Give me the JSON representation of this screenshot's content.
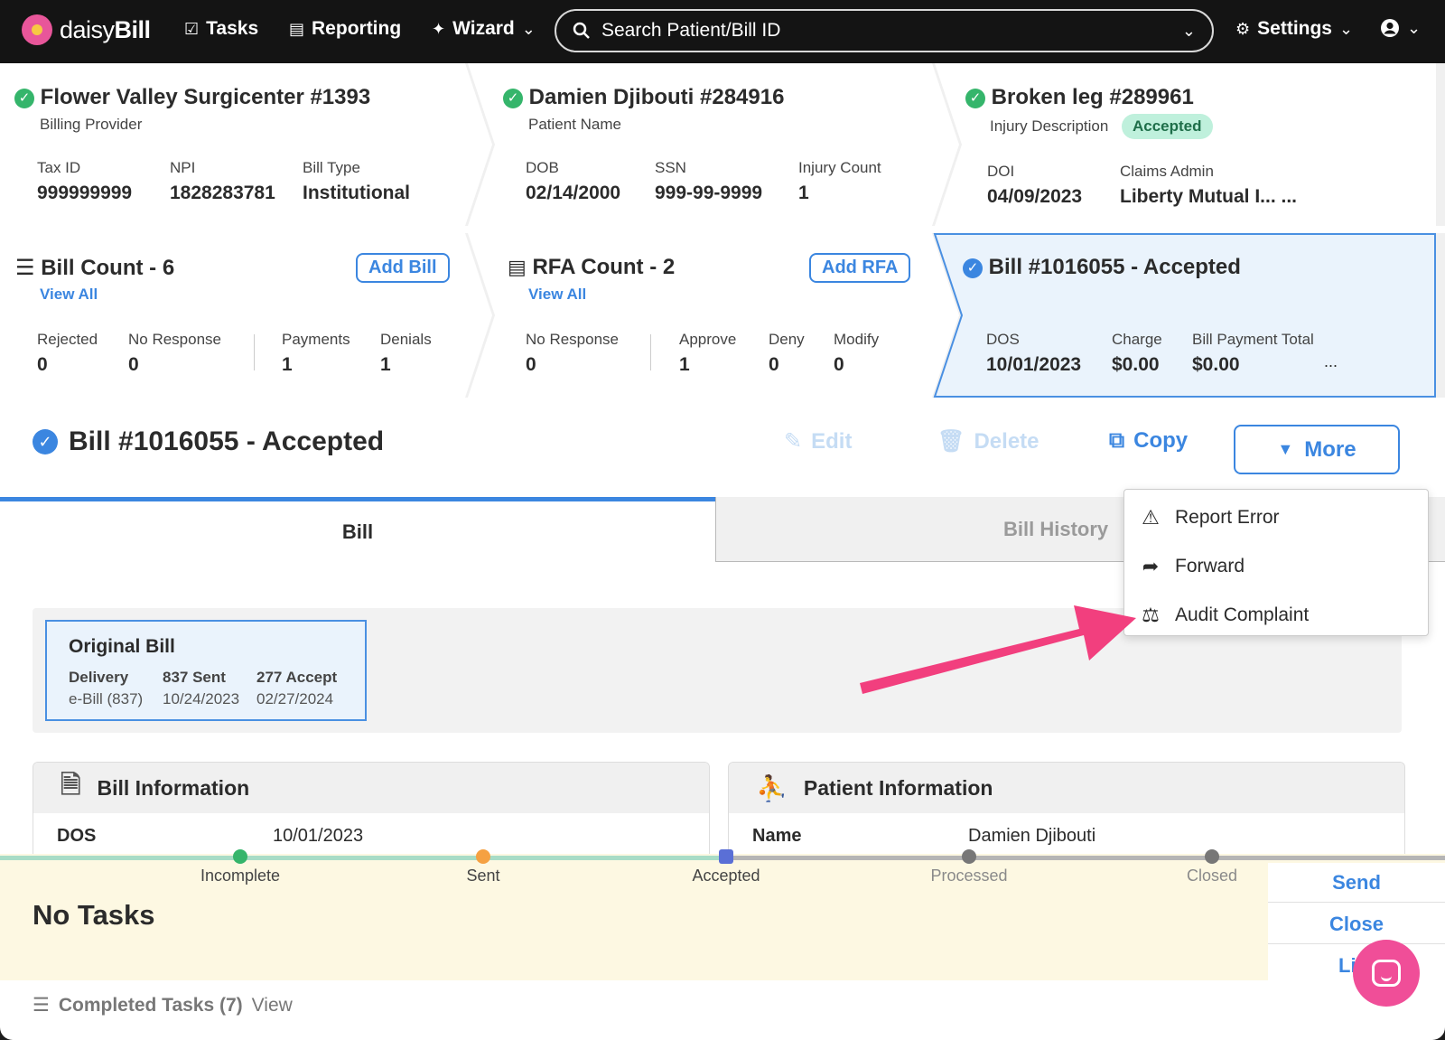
{
  "nav": {
    "logo_light": "daisy",
    "logo_bold": "Bill",
    "tasks": "Tasks",
    "reporting": "Reporting",
    "wizard": "Wizard",
    "search_placeholder": "Search Patient/Bill ID",
    "settings": "Settings"
  },
  "provider": {
    "title": "Flower Valley Surgicenter #1393",
    "subtitle": "Billing Provider",
    "fields": [
      {
        "label": "Tax ID",
        "value": "999999999"
      },
      {
        "label": "NPI",
        "value": "1828283781"
      },
      {
        "label": "Bill Type",
        "value": "Institutional"
      }
    ]
  },
  "patient": {
    "title": "Damien Djibouti #284916",
    "subtitle": "Patient Name",
    "fields": [
      {
        "label": "DOB",
        "value": "02/14/2000"
      },
      {
        "label": "SSN",
        "value": "999-99-9999"
      },
      {
        "label": "Injury Count",
        "value": "1"
      }
    ]
  },
  "injury": {
    "title": "Broken leg #289961",
    "subtitle": "Injury Description",
    "badge": "Accepted",
    "fields": [
      {
        "label": "DOI",
        "value": "04/09/2023"
      },
      {
        "label": "Claims Admin",
        "value": "Liberty Mutual I... ..."
      }
    ]
  },
  "bill_count": {
    "title": "Bill Count - 6",
    "view_all": "View All",
    "add": "Add Bill",
    "fields": [
      {
        "label": "Rejected",
        "value": "0"
      },
      {
        "label": "No Response",
        "value": "0"
      },
      {
        "label": "Payments",
        "value": "1"
      },
      {
        "label": "Denials",
        "value": "1"
      }
    ]
  },
  "rfa_count": {
    "title": "RFA Count - 2",
    "view_all": "View All",
    "add": "Add RFA",
    "fields": [
      {
        "label": "No Response",
        "value": "0"
      },
      {
        "label": "Approve",
        "value": "1"
      },
      {
        "label": "Deny",
        "value": "0"
      },
      {
        "label": "Modify",
        "value": "0"
      }
    ]
  },
  "bill_card": {
    "title": "Bill #1016055 - Accepted",
    "fields": [
      {
        "label": "DOS",
        "value": "10/01/2023"
      },
      {
        "label": "Charge",
        "value": "$0.00"
      },
      {
        "label": "Bill Payment Total",
        "value": "$0.00"
      }
    ],
    "ellipsis": "..."
  },
  "bill_header": {
    "title": "Bill #1016055 - Accepted",
    "edit": "Edit",
    "delete": "Delete",
    "copy": "Copy",
    "more": "More"
  },
  "tabs": {
    "bill": "Bill",
    "history": "Bill History"
  },
  "more_menu": [
    {
      "label": "Report Error",
      "icon": "warning-icon"
    },
    {
      "label": "Forward",
      "icon": "forward-icon"
    },
    {
      "label": "Audit Complaint",
      "icon": "scale-icon"
    }
  ],
  "original_bill": {
    "title": "Original Bill",
    "cols": [
      {
        "head": "Delivery",
        "value": "e-Bill (837)"
      },
      {
        "head": "837 Sent",
        "value": "10/24/2023"
      },
      {
        "head": "277 Accept",
        "value": "02/27/2024"
      }
    ]
  },
  "bill_info": {
    "title": "Bill Information",
    "label": "DOS",
    "value": "10/01/2023"
  },
  "patient_info": {
    "title": "Patient Information",
    "label": "Name",
    "value": "Damien Djibouti"
  },
  "status": {
    "stages": [
      "Incomplete",
      "Sent",
      "Accepted",
      "Processed",
      "Closed"
    ],
    "no_tasks": "No Tasks",
    "send": "Send",
    "close": "Close",
    "li": "Li"
  },
  "completed": {
    "label": "Completed Tasks (7)",
    "view": "View"
  },
  "colors": {
    "accent": "#3b86e0",
    "success": "#35b56b",
    "arrow": "#f23f7e",
    "chat": "#f04e98"
  }
}
